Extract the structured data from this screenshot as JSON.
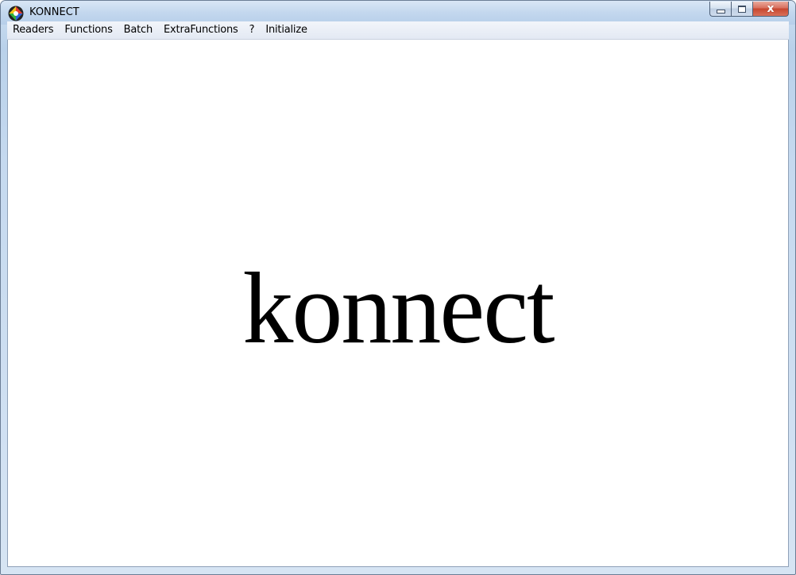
{
  "window": {
    "title": "KONNECT",
    "close_glyph": "x"
  },
  "menu": {
    "items": [
      "Readers",
      "Functions",
      "Batch",
      "ExtraFunctions",
      "?",
      "Initialize"
    ]
  },
  "content": {
    "logo_text": "konnect"
  },
  "icons": {
    "app": "konnect-app-icon",
    "minimize": "minimize-icon",
    "maximize": "maximize-icon",
    "close": "close-icon"
  },
  "colors": {
    "titlebar": "#c3d7ee",
    "close_button": "#c7462e",
    "logo": "#000000"
  }
}
